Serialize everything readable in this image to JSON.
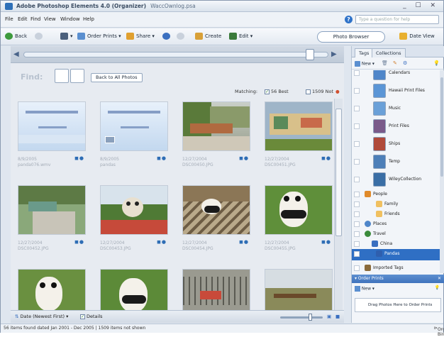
{
  "window": {
    "title": "Adobe Photoshop Elements 4.0 (Organizer)",
    "doc": "WaccOwnlog.psa",
    "controls": "_ ☐ ✕"
  },
  "menubar": {
    "items": [
      "File",
      "Edit",
      "Find",
      "View",
      "Window",
      "Help"
    ],
    "help_placeholder": "Type a question for help"
  },
  "toolbar": {
    "back": "Back",
    "order_prints": "Order Prints ▾",
    "share": "Share ▾",
    "create": "Create",
    "edit": "Edit ▾",
    "photo_browser": "Photo Browser",
    "date_view": "Date View"
  },
  "find": {
    "label": "Find:",
    "back_button": "Back to All Photos",
    "matching": "Matching:",
    "best_count": "56 Best",
    "not_count": "1509 Not"
  },
  "photos": [
    {
      "date": "8/9/2005",
      "name": "panda076.wmv",
      "kind": "slide1"
    },
    {
      "date": "8/9/2005",
      "name": "pandas",
      "kind": "slide2"
    },
    {
      "date": "12/27/2004",
      "name": "DSC00450.JPG",
      "kind": "park"
    },
    {
      "date": "12/27/2004",
      "name": "DSC00451.JPG",
      "kind": "mural"
    },
    {
      "date": "12/27/2004",
      "name": "DSC00452.JPG",
      "kind": "road"
    },
    {
      "date": "12/27/2004",
      "name": "DSC00453.JPG",
      "kind": "statue"
    },
    {
      "date": "12/27/2004",
      "name": "DSC00454.JPG",
      "kind": "panda1"
    },
    {
      "date": "12/27/2004",
      "name": "DSC00455.JPG",
      "kind": "panda2"
    },
    {
      "date": "",
      "name": "",
      "kind": "panda3"
    },
    {
      "date": "",
      "name": "",
      "kind": "panda4"
    },
    {
      "date": "",
      "name": "",
      "kind": "fence"
    },
    {
      "date": "",
      "name": "",
      "kind": "woods"
    }
  ],
  "bottombar": {
    "sort": "Date (Newest First)",
    "details": "Details"
  },
  "status": {
    "left": "56 items found dated Jan 2001 - Dec 2005  |  1509 items not shown",
    "right": "Organize Bin"
  },
  "tags": {
    "tab_tags": "Tags",
    "tab_collections": "Collections",
    "new_label": "New ▾",
    "items": [
      {
        "label": "Calendars",
        "color": "#4f86c9"
      },
      {
        "label": "Hawaii Print Files",
        "color": "#5a95d6"
      },
      {
        "label": "Music",
        "color": "#6aa0d8"
      },
      {
        "label": "Print Files",
        "color": "#7a5a8a"
      },
      {
        "label": "Ships",
        "color": "#b04a3a"
      },
      {
        "label": "Temp",
        "color": "#4d7fb8"
      },
      {
        "label": "WileyCollection",
        "color": "#3a6ea5"
      }
    ],
    "people": "People",
    "family": "Family",
    "friends": "Friends",
    "places": "Places",
    "travel": "Travel",
    "china": "China",
    "pandas": "Pandas",
    "imported": "Imported Tags"
  },
  "order_prints": {
    "title": "Order Prints",
    "new_label": "New ▾",
    "drop_text": "Drag Photos Here to Order Prints"
  }
}
